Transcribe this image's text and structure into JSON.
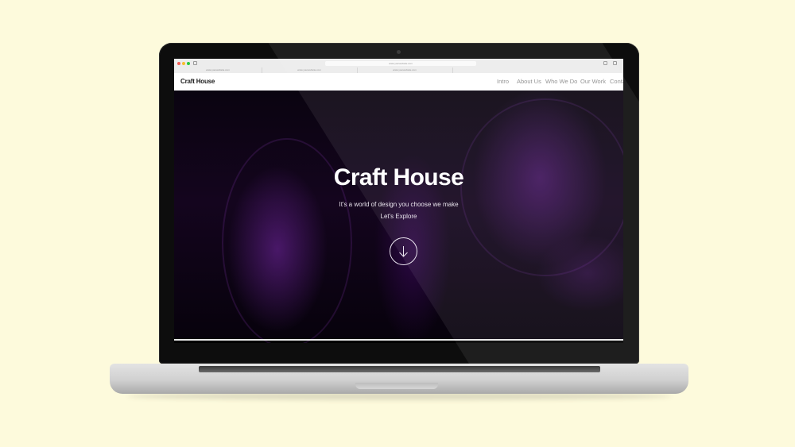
{
  "browser": {
    "url": "www.yourwebsite.com",
    "tabs": [
      "www.yourwebsite.com",
      "www.yourwebsite.com",
      "www.yourwebsite.com"
    ]
  },
  "site": {
    "brand": "Craft House",
    "nav": [
      "Intro",
      "About Us",
      "Who We Do",
      "Our Work",
      "Conta"
    ]
  },
  "hero": {
    "title": "Craft House",
    "subtitle": "It's a world of design you choose we make",
    "cta": "Let's Explore",
    "scroll_icon": "arrow-down-circle-icon"
  },
  "colors": {
    "background": "#fdfadc",
    "accent": "#6b1fa5",
    "nav_text": "#8d8d8d"
  }
}
